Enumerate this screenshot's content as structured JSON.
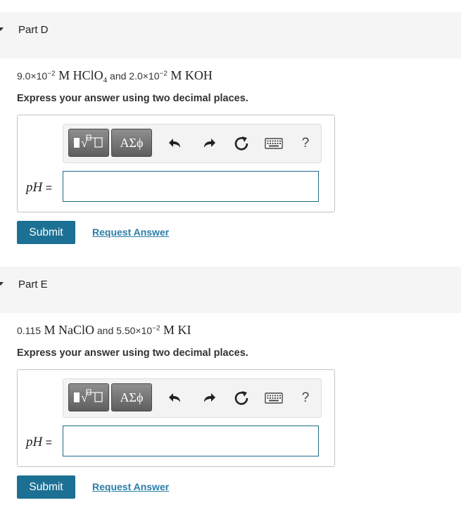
{
  "parts": [
    {
      "title": "Part D",
      "question": {
        "c1": "9.0×10",
        "c1_exp": "−2",
        "m1": " M HClO",
        "m1_sub": "4",
        "and": " and ",
        "c2": "2.0×10",
        "c2_exp": "−2",
        "m2": " M KOH"
      },
      "instruction": "Express your answer using two decimal places.",
      "toolbar": {
        "greek_label": "ΑΣϕ",
        "help_label": "?"
      },
      "answer_label": "pH",
      "equals": " =",
      "answer_value": "",
      "submit_label": "Submit",
      "request_label": "Request Answer"
    },
    {
      "title": "Part E",
      "question": {
        "c1": "0.115",
        "c1_exp": "",
        "m1": " M NaClO",
        "m1_sub": "",
        "and": " and ",
        "c2": "5.50×10",
        "c2_exp": "−2",
        "m2": " M KI"
      },
      "instruction": "Express your answer using two decimal places.",
      "toolbar": {
        "greek_label": "ΑΣϕ",
        "help_label": "?"
      },
      "answer_label": "pH",
      "equals": " =",
      "answer_value": "",
      "submit_label": "Submit",
      "request_label": "Request Answer"
    }
  ],
  "icons": [
    "templates-icon",
    "undo-icon",
    "redo-icon",
    "reset-icon",
    "keyboard-icon",
    "help-icon"
  ]
}
